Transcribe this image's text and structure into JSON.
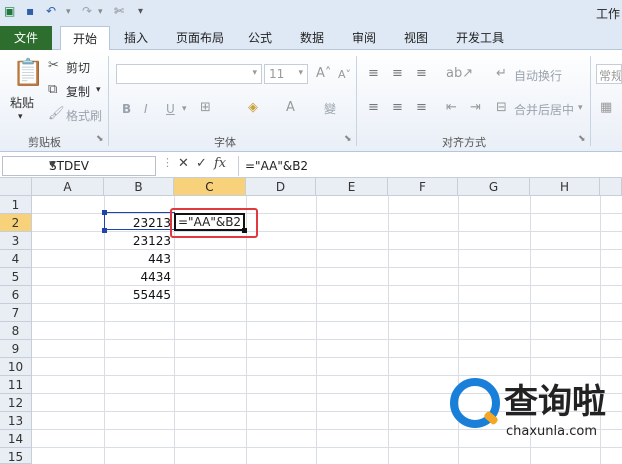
{
  "window": {
    "title_partial": "工作"
  },
  "qat": {
    "icons": [
      "excel-icon",
      "save-icon",
      "undo-icon",
      "redo-icon",
      "customize-icon"
    ]
  },
  "tabs": [
    {
      "label": "文件"
    },
    {
      "label": "开始"
    },
    {
      "label": "插入"
    },
    {
      "label": "页面布局"
    },
    {
      "label": "公式"
    },
    {
      "label": "数据"
    },
    {
      "label": "审阅"
    },
    {
      "label": "视图"
    },
    {
      "label": "开发工具"
    }
  ],
  "ribbon": {
    "clipboard": {
      "paste": "粘贴",
      "cut": "剪切",
      "copy": "复制",
      "format_painter": "格式刷",
      "label": "剪贴板"
    },
    "font": {
      "size": "11",
      "bold": "B",
      "italic": "I",
      "underline": "U",
      "phonetic": "變",
      "label": "字体"
    },
    "alignment": {
      "wrap_text": "自动换行",
      "merge_center": "合并后居中",
      "label": "对齐方式"
    },
    "number": {
      "format": "常规"
    }
  },
  "formula_bar": {
    "name_box": "STDEV",
    "cancel_icon": "✕",
    "enter_icon": "✓",
    "fx_label": "fx",
    "formula": "=\"AA\"&B2"
  },
  "sheet": {
    "columns": [
      "A",
      "B",
      "C",
      "D",
      "E",
      "F",
      "G",
      "H"
    ],
    "rows": [
      "1",
      "2",
      "3",
      "4",
      "5",
      "6",
      "7",
      "8",
      "9",
      "10",
      "11",
      "12",
      "13",
      "14",
      "15"
    ],
    "selected_column": "C",
    "selected_row": "2",
    "cells": [
      {
        "ref": "B2",
        "value": "23213"
      },
      {
        "ref": "B3",
        "value": "23123"
      },
      {
        "ref": "B4",
        "value": "443"
      },
      {
        "ref": "B5",
        "value": "4434"
      },
      {
        "ref": "B6",
        "value": "55445"
      }
    ],
    "active_cell": {
      "ref": "C2",
      "value": "=\"AA\"&B2"
    }
  },
  "watermark": {
    "text_cn": "查询啦",
    "text_en": "chaxunla.com"
  },
  "colors": {
    "file_tab": "#2d6d2d",
    "selected_header": "#f8d27a",
    "highlight_box": "#e0393e",
    "copy_border": "#2244aa"
  }
}
